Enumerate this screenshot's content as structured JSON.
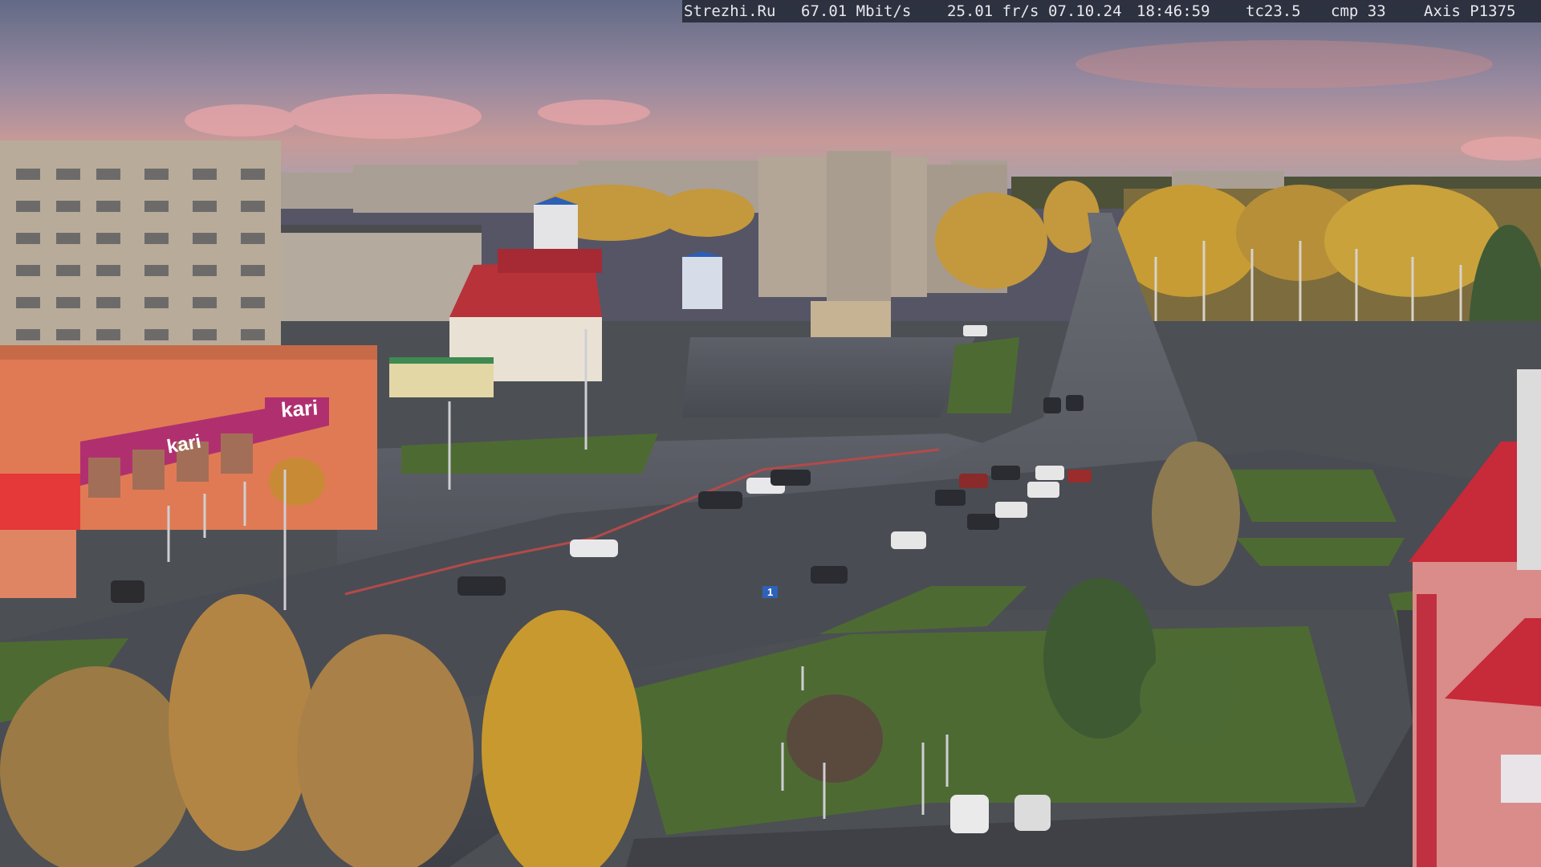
{
  "overlay": {
    "site": "Strezhi.Ru",
    "bitrate": "67.01 Mbit/s",
    "framerate": "25.01 fr/s",
    "date": "07.10.24",
    "time": "18:46:59",
    "temp": "tc23.5",
    "compression": "cmp 33",
    "camera": "Axis P1375"
  },
  "signs": {
    "kari_main": "kari",
    "kari_second": "kari",
    "road_sign_number": "1"
  },
  "colors": {
    "sky_top": "#6b6f86",
    "sky_mid": "#b88f9a",
    "sky_horizon": "#d6a08a",
    "asphalt": "#4a4d55",
    "grass": "#4f6b34",
    "foliage": "#c99a3a",
    "panel_building": "#b9aa98",
    "kari_brand": "#b0306f",
    "roof_red": "#b8323a"
  }
}
